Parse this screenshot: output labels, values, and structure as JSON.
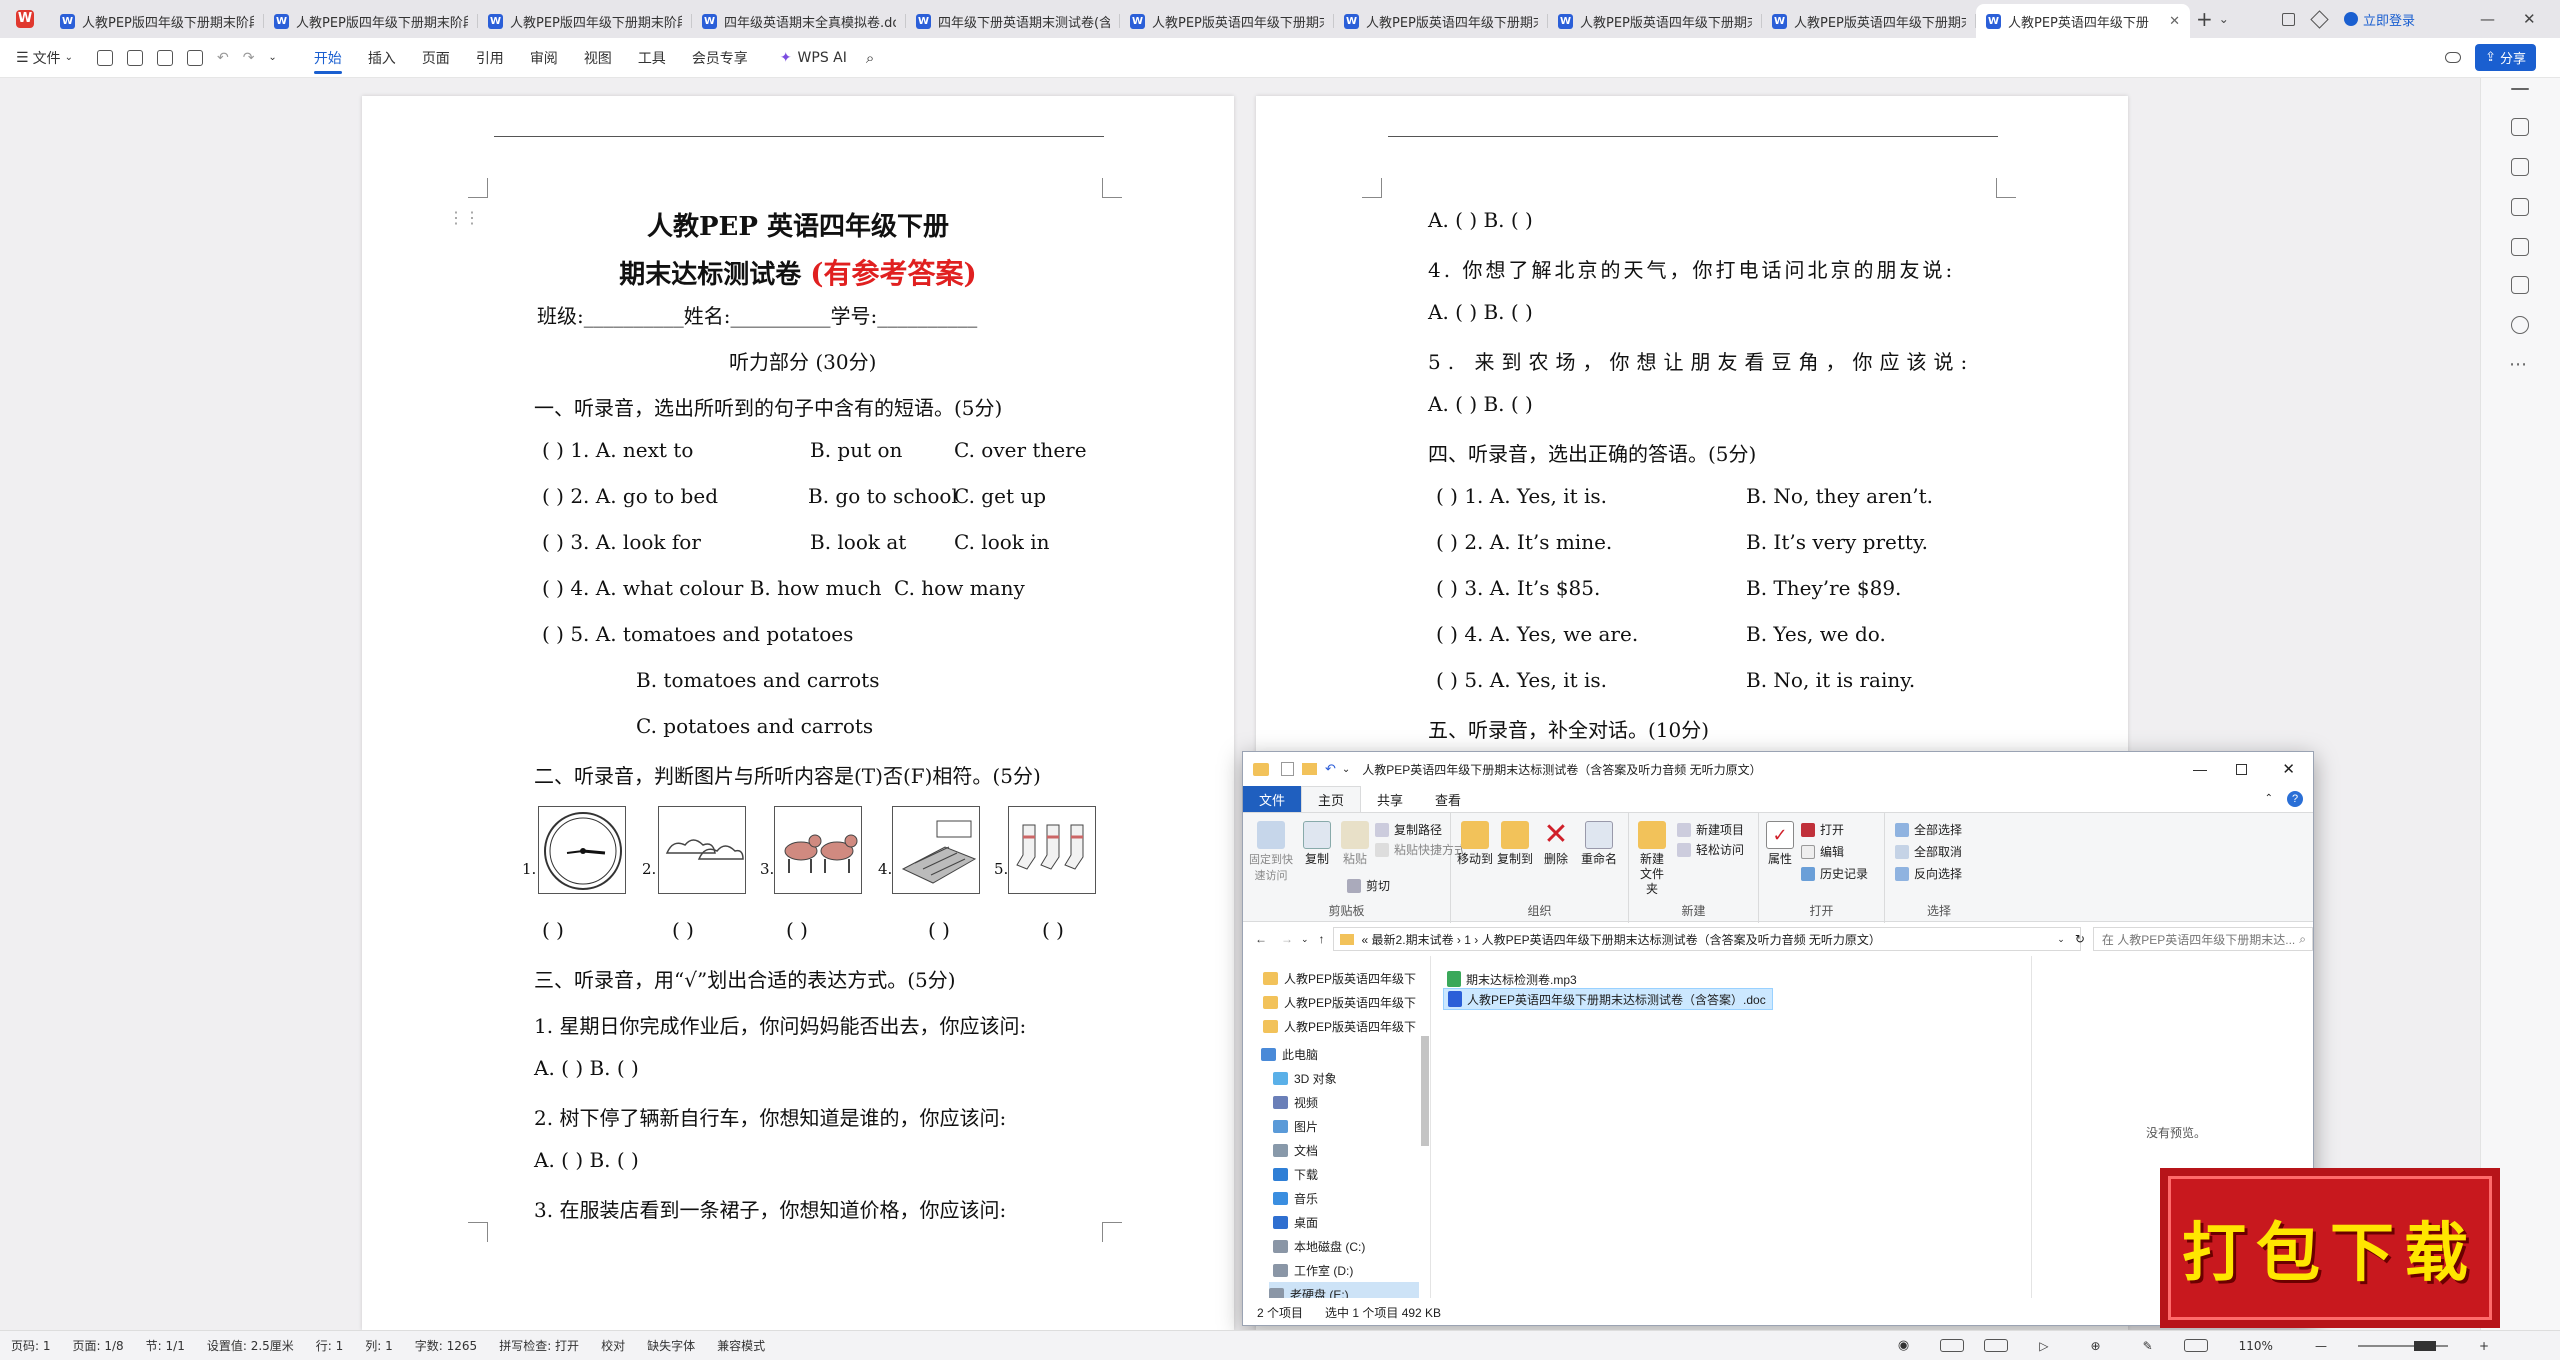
{
  "tabs": [
    {
      "label": "人教PEP版四年级下册期末阶段",
      "icon": "W",
      "color": "#2b5fd8"
    },
    {
      "label": "人教PEP版四年级下册期末阶段",
      "icon": "W",
      "color": "#2b5fd8"
    },
    {
      "label": "人教PEP版四年级下册期末阶段",
      "icon": "W",
      "color": "#2b5fd8"
    },
    {
      "label": "四年级英语期末全真模拟卷.doc",
      "icon": "W",
      "color": "#2b5fd8"
    },
    {
      "label": "四年级下册英语期末测试卷(含答",
      "icon": "W",
      "color": "#2b5fd8"
    },
    {
      "label": "人教PEP版英语四年级下册期末",
      "icon": "W",
      "color": "#2b5fd8"
    },
    {
      "label": "人教PEP版英语四年级下册期末",
      "icon": "W",
      "color": "#2b5fd8"
    },
    {
      "label": "人教PEP版英语四年级下册期末",
      "icon": "W",
      "color": "#2b5fd8"
    },
    {
      "label": "人教PEP版英语四年级下册期末",
      "icon": "W",
      "color": "#2b5fd8"
    },
    {
      "label": "人教PEP英语四年级下册",
      "icon": "W",
      "color": "#2b5fd8"
    }
  ],
  "login_label": "立即登录",
  "toolbar": {
    "file": "文件",
    "menus": [
      "开始",
      "插入",
      "页面",
      "引用",
      "审阅",
      "视图",
      "工具",
      "会员专享"
    ],
    "wps_ai": "WPS AI",
    "share": "分享"
  },
  "doc": {
    "title1": "人教PEP 英语四年级下册",
    "title2a": "期末达标测试卷",
    "title2b": "(有参考答案)",
    "info": "班级:__________姓名:__________学号:__________",
    "part": "听力部分 (30分)",
    "s1": "一、听录音，选出所听到的句子中含有的短语。(5分)",
    "s1_items": [
      [
        "(      ) 1. A. next to",
        "B. put on",
        "C. over there"
      ],
      [
        "(      ) 2. A. go to bed",
        "B. go to school",
        "C. get up"
      ],
      [
        "(      ) 3. A. look for",
        "B. look at",
        "C. look in"
      ],
      [
        "(      ) 4. A. what colour B. how much",
        "",
        "C. how many"
      ]
    ],
    "s1_q5": "(      ) 5. A. tomatoes and potatoes",
    "s1_q5b": "B. tomatoes and carrots",
    "s1_q5c": "C. potatoes and carrots",
    "s2": "二、听录音，判断图片与所听内容是(T)否(F)相符。(5分)",
    "pic_nums": [
      "1.",
      "2.",
      "3.",
      "4.",
      "5."
    ],
    "pic_brackets": [
      "(      )",
      "(      )",
      "(      )",
      "(      )",
      "(      )"
    ],
    "s3": "三、听录音，用“√”划出合适的表达方式。(5分)",
    "s3_1": "1. 星期日你完成作业后，你问妈妈能否出去，你应该问:",
    "s3_ab": "A. (      )      B. (      )",
    "s3_2": "2. 树下停了辆新自行车，你想知道是谁的，你应该问:",
    "s3_3": "3. 在服装店看到一条裙子，你想知道价格，你应该问:",
    "p2_ab": "A. (      )        B. (      )",
    "p2_4": "4. 你想了解北京的天气，你打电话问北京的朋友说:",
    "p2_5": "5. 来到农场，你想让朋友看豆角，你应该说:",
    "s4": "四、听录音，选出正确的答语。(5分)",
    "s4_items": [
      [
        "(      ) 1. A. Yes, it is.",
        "B. No, they aren’t."
      ],
      [
        "(      ) 2. A. It’s mine.",
        "B. It’s very pretty."
      ],
      [
        "(      ) 3. A. It’s $85.",
        "B. They’re $89."
      ],
      [
        "(      ) 4. A. Yes, we are.",
        "B. Yes, we do."
      ],
      [
        "(      ) 5. A. Yes, it is.",
        "B. No, it is rainy."
      ]
    ],
    "s5": "五、听录音，补全对话。(10分)"
  },
  "explorer": {
    "title": "人教PEP英语四年级下册期末达标测试卷（含答案及听力音频 无听力原文）",
    "tabs": [
      "文件",
      "主页",
      "共享",
      "查看"
    ],
    "ribbon": {
      "pin": "固定到快速访问",
      "copy": "复制",
      "paste": "粘贴",
      "copy_path": "复制路径",
      "paste_shortcut": "粘贴快捷方式",
      "cut": "剪切",
      "move_to": "移动到",
      "copy_to": "复制到",
      "delete": "删除",
      "rename": "重命名",
      "new_folder": "新建文件夹",
      "new_item": "新建项目",
      "easy_access": "轻松访问",
      "properties": "属性",
      "open": "打开",
      "edit": "编辑",
      "history": "历史记录",
      "select_all": "全部选择",
      "select_none": "全部取消",
      "invert": "反向选择",
      "groups": [
        "剪贴板",
        "组织",
        "新建",
        "打开",
        "选择"
      ]
    },
    "address": "«   最新2.期末试卷   ›   1   ›   人教PEP英语四年级下册期末达标测试卷（含答案及听力音频 无听力原文）",
    "search_placeholder": "在 人教PEP英语四年级下册期末达...",
    "nav": [
      {
        "label": "人教PEP版英语四年级下",
        "type": "folder"
      },
      {
        "label": "人教PEP版英语四年级下",
        "type": "folder"
      },
      {
        "label": "人教PEP版英语四年级下",
        "type": "folder"
      },
      {
        "label": "此电脑",
        "type": "pc"
      },
      {
        "label": "3D 对象",
        "type": "obj3d"
      },
      {
        "label": "视频",
        "type": "video"
      },
      {
        "label": "图片",
        "type": "pic"
      },
      {
        "label": "文档",
        "type": "doc"
      },
      {
        "label": "下载",
        "type": "down"
      },
      {
        "label": "音乐",
        "type": "music"
      },
      {
        "label": "桌面",
        "type": "desk"
      },
      {
        "label": "本地磁盘 (C:)",
        "type": "disk"
      },
      {
        "label": "工作室 (D:)",
        "type": "disk"
      },
      {
        "label": "老硬盘 (E:)",
        "type": "disk"
      }
    ],
    "files": [
      {
        "name": "期末达标检测卷.mp3",
        "type": "audio"
      },
      {
        "name": "人教PEP英语四年级下册期末达标测试卷（含答案）.doc",
        "type": "word"
      }
    ],
    "no_preview": "没有预览。",
    "status": [
      "2 个项目",
      "选中 1 个项目  492 KB"
    ]
  },
  "status": [
    "页码: 1",
    "页面: 1/8",
    "节: 1/1",
    "设置值: 2.5厘米",
    "行: 1",
    "列: 1",
    "字数: 1265",
    "拼写检查: 打开",
    "校对",
    "缺失字体",
    "兼容模式"
  ],
  "zoom": "110%",
  "download_badge": "打包下载"
}
